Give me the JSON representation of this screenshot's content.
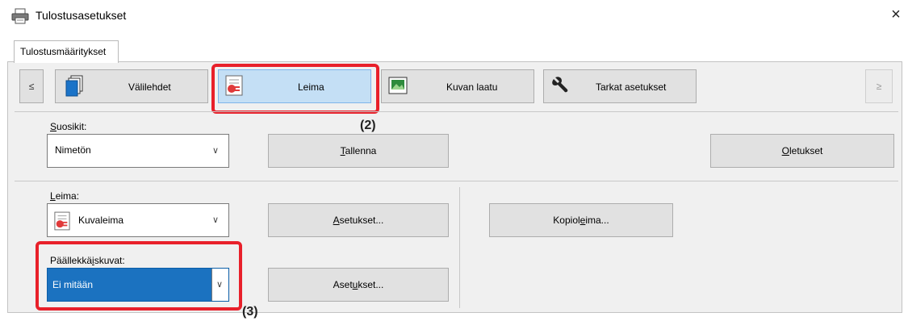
{
  "window": {
    "title": "Tulostusasetukset",
    "close_glyph": "×",
    "icon": "printer-icon"
  },
  "tab": {
    "label": "Tulostusmääritykset"
  },
  "toolbar": {
    "prev_glyph": "≤",
    "next_glyph": "≥",
    "buttons": [
      {
        "label": "Välilehdet",
        "icon": "pages-icon"
      },
      {
        "label": "Leima",
        "icon": "stamp-icon",
        "active": true
      },
      {
        "label": "Kuvan laatu",
        "icon": "image-quality-icon"
      },
      {
        "label": "Tarkat asetukset",
        "icon": "wrench-icon"
      }
    ]
  },
  "favorites": {
    "label": "Suosikit:",
    "value": "Nimetön",
    "save_button": "Tallenna",
    "defaults_button": "Oletukset"
  },
  "stamp": {
    "label": "Leima:",
    "value": "Kuvaleima",
    "settings_button": "Asetukset...",
    "copy_stamp_button": "Kopioleima..."
  },
  "overlays": {
    "label": "Päällekkäiskuvat:",
    "value": "Ei mitään",
    "settings_button": "Asetukset..."
  },
  "callouts": {
    "two": "(2)",
    "three": "(3)"
  },
  "colors": {
    "highlight": "#e8202a",
    "selected": "#1b72c0",
    "active_button": "#c4dff5"
  }
}
